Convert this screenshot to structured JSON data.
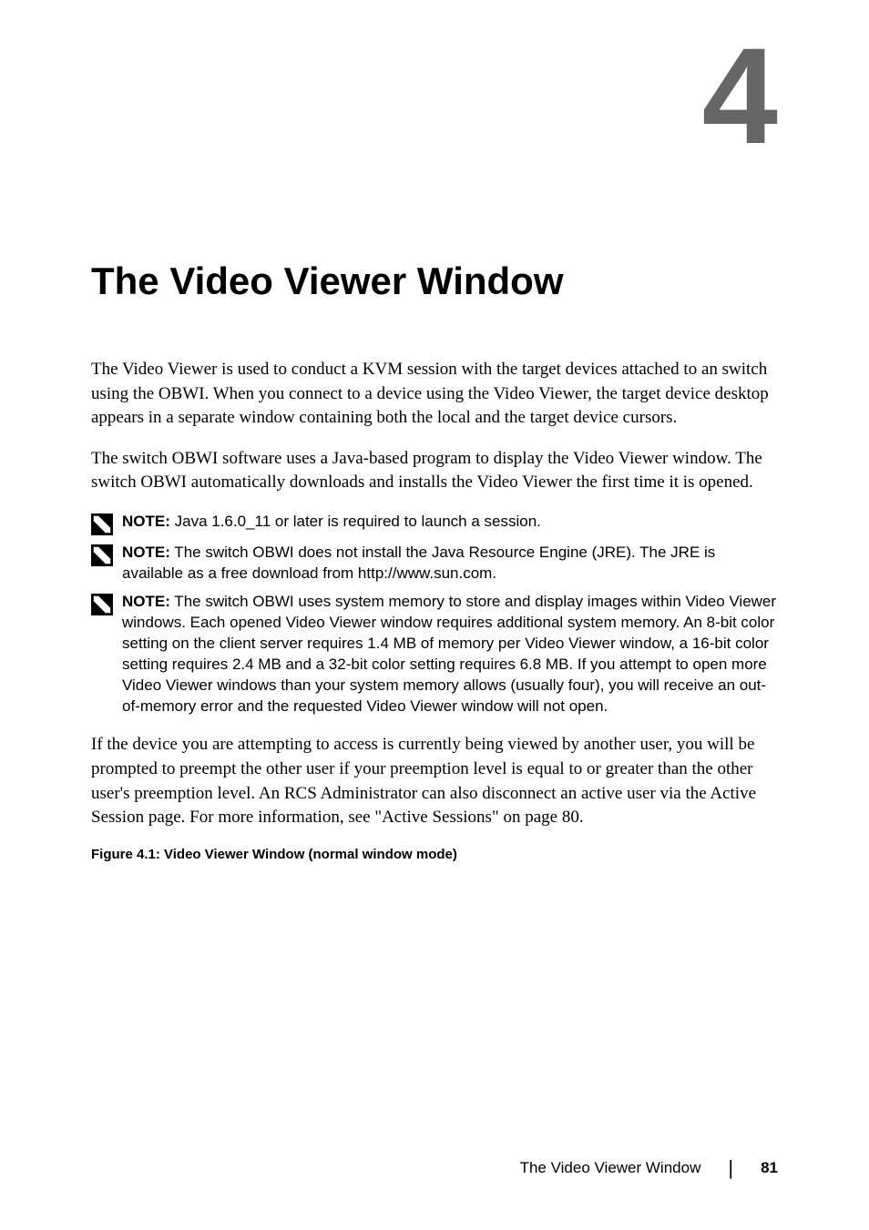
{
  "chapter_number": "4",
  "heading": "The Video Viewer Window",
  "para1": "The Video Viewer is used to conduct a KVM session with the target devices attached to an switch using the OBWI. When you connect to a device using the Video Viewer, the target device desktop appears in a separate window containing both the local and the target device cursors.",
  "para2": "The switch OBWI software uses a Java-based program to display the Video Viewer window. The switch  OBWI automatically downloads and installs the Video Viewer the first time it is opened.",
  "notes": [
    {
      "label": "NOTE:",
      "text": " Java 1.6.0_11 or later is required to launch a session."
    },
    {
      "label": "NOTE:",
      "text": " The switch OBWI does not install the Java Resource Engine (JRE). The JRE is available as a free download from http://www.sun.com."
    },
    {
      "label": "NOTE:",
      "text": " The switch OBWI uses system memory to store and display images within Video Viewer windows. Each opened Video Viewer window requires additional system memory. An 8-bit color setting on the client server requires 1.4 MB of memory per Video Viewer window, a 16-bit color setting requires 2.4 MB and a 32-bit color setting requires 6.8 MB. If you attempt to open more Video Viewer windows than your system memory allows (usually four), you will receive an out-of-memory error and the requested Video Viewer window will not open."
    }
  ],
  "para3": "If the device you are attempting to access is currently being viewed by another user, you will be prompted to preempt the other user if your preemption level is equal to or greater than the other user's preemption level. An RCS Administrator can also disconnect an active user via the Active Session page. For more information, see \"Active Sessions\" on page 80.",
  "figure_caption": "Figure 4.1: Video Viewer Window (normal window mode)",
  "footer_title": "The Video Viewer Window",
  "footer_page": "81"
}
